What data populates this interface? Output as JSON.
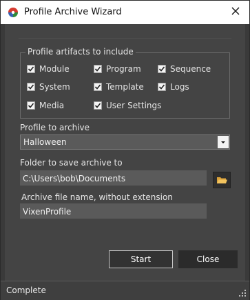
{
  "window": {
    "title": "Profile Archive Wizard"
  },
  "artifacts_group": {
    "legend": "Profile artifacts to include",
    "items": [
      {
        "label": "Module",
        "checked": true
      },
      {
        "label": "Program",
        "checked": true
      },
      {
        "label": "Sequence",
        "checked": true
      },
      {
        "label": "System",
        "checked": true
      },
      {
        "label": "Template",
        "checked": true
      },
      {
        "label": "Logs",
        "checked": true
      },
      {
        "label": "Media",
        "checked": true
      },
      {
        "label": "User Settings",
        "checked": true
      }
    ]
  },
  "profile_select": {
    "label": "Profile to archive",
    "value": "Halloween"
  },
  "folder": {
    "label": "Folder to save archive to",
    "value": "C:\\Users\\bob\\Documents"
  },
  "filename": {
    "label": "Archive file name, without extension",
    "value": "VixenProfile"
  },
  "buttons": {
    "start": "Start",
    "close": "Close"
  },
  "status": {
    "text": "Complete"
  },
  "colors": {
    "window_bg": "#444444",
    "field_bg": "#5a5a5a",
    "titlebar_bg": "#ffffff",
    "folder_icon": "#f2b84b",
    "logo_red": "#d63a2f",
    "logo_green": "#2e8b3a"
  },
  "icons": {
    "app": "vixen-logo-icon",
    "close": "close-icon",
    "folder": "folder-open-icon",
    "dropdown": "chevron-down-icon",
    "grip": "resize-grip-icon"
  }
}
